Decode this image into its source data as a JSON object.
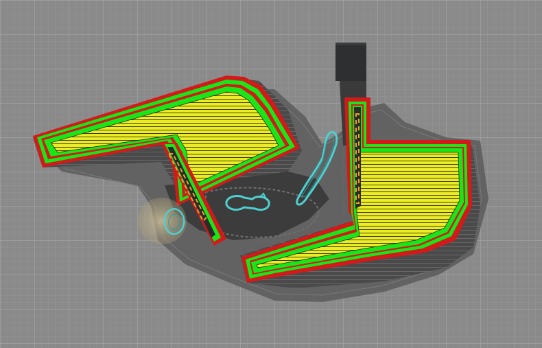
{
  "scene": {
    "type": "slicer-layer-preview",
    "colors": {
      "bed": "#8a8a8a",
      "bed_grid_minor": "#959595",
      "bed_grid_major": "#a3a3a3",
      "lower_layers": "#4a4a4a",
      "lower_layers_edge": "#6e6e6e",
      "shadow": "#5c5c5c",
      "outer_wall": "#d21a1a",
      "inner_wall": "#19e619",
      "infill": "#ecec26",
      "infill_line": "#2a2a10",
      "support_interface": "#f0a030",
      "travel_highlight": "#4ed0d0",
      "ghost_object": "#c9b98a",
      "tower_block": "#2e2f30"
    },
    "features": [
      "outer-wall",
      "inner-wall",
      "sparse-infill",
      "support-interface",
      "lower-layers",
      "travel-loop",
      "ghost-object"
    ]
  }
}
